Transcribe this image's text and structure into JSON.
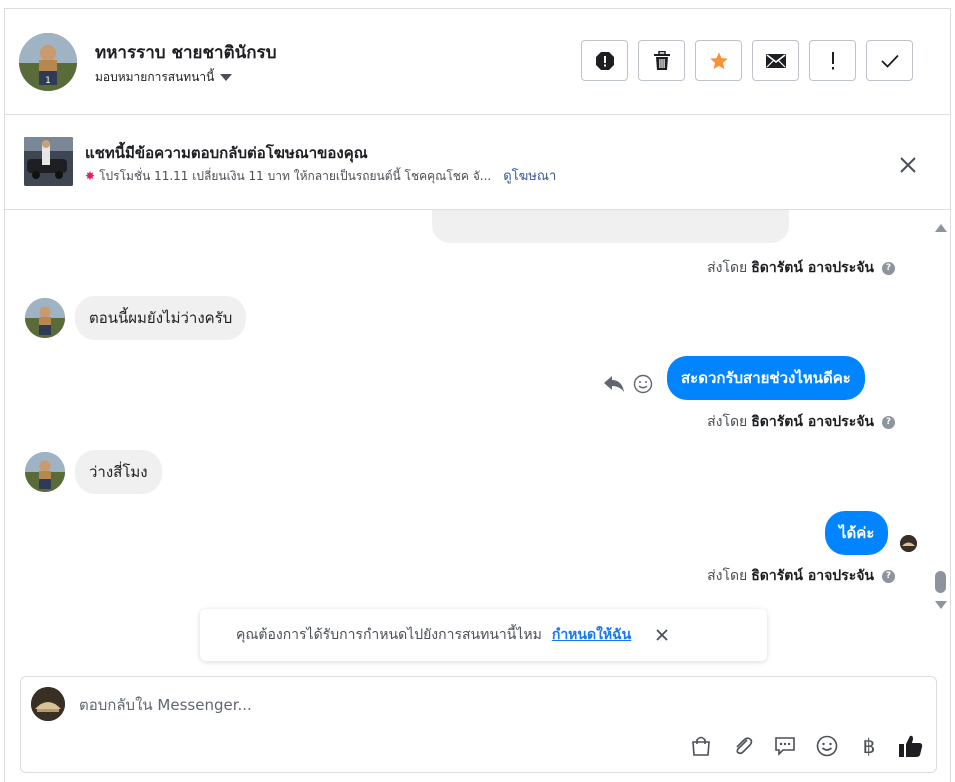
{
  "header": {
    "contact_name": "ทหารราบ ชายชาตินักรบ",
    "assign_label": "มอบหมายการสนทนานี้",
    "toolbar": [
      {
        "icon": "alert-octagon-icon",
        "name": "spam-button"
      },
      {
        "icon": "trash-icon",
        "name": "delete-button"
      },
      {
        "icon": "star-icon",
        "name": "star-button"
      },
      {
        "icon": "envelope-icon",
        "name": "mark-unread-button"
      },
      {
        "icon": "exclamation-icon",
        "name": "follow-up-button"
      },
      {
        "icon": "check-icon",
        "name": "mark-done-button"
      }
    ],
    "star_color": "#f7923b"
  },
  "ad_banner": {
    "title": "แชทนี้มีข้อความตอบกลับต่อโฆษณาของคุณ",
    "subtitle": "โปรโมชั่น 11.11 เปลี่ยนเงิน 11 บาท ให้กลายเป็นรถยนต์นี้ โชคคุณโชค จั...",
    "link": "ดูโฆษณา"
  },
  "messages": {
    "sent_by_prefix": "ส่งโดย",
    "agent_name": "ธิดารัตน์ อาจประจัน",
    "incoming_1": "ตอนนี้ผมยังไม่ว่างครับ",
    "outgoing_1": "สะดวกรับสายช่วงไหนดีคะ",
    "incoming_2": "ว่างสี่โมง",
    "outgoing_2": "ได้ค่ะ"
  },
  "assign_toast": {
    "text": "คุณต้องการได้รับการกำหนดไปยังการสนทนานี้ไหม",
    "link": "กำหนดให้ฉัน"
  },
  "composer": {
    "placeholder": "ตอบกลับใน Messenger...",
    "tools": [
      "shopping-bag-icon",
      "paperclip-icon",
      "saved-reply-icon",
      "emoji-icon",
      "baht-icon",
      "thumbs-up-icon"
    ],
    "baht_glyph": "฿"
  },
  "colors": {
    "accent": "#0084ff",
    "link": "#385898"
  }
}
